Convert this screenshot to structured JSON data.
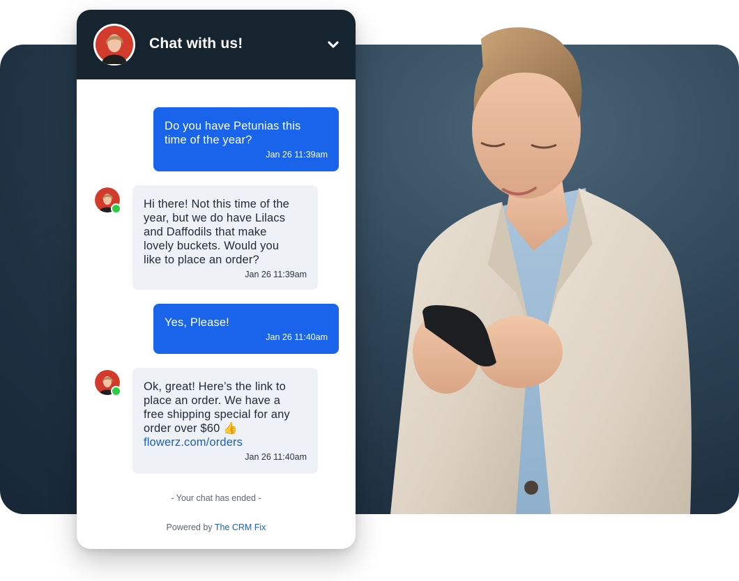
{
  "colors": {
    "header_bg": "#16242f",
    "outgoing_bubble": "#1a63eb",
    "incoming_bubble": "#eef2f6",
    "link": "#1b5fb8",
    "online_status": "#2ecc40",
    "backdrop": "#2f4658"
  },
  "chat": {
    "title": "Chat with us!",
    "toggle_icon": "chevron-down-icon",
    "messages": [
      {
        "direction": "outgoing",
        "text": "Do you have Petunias this\ntime of the year?",
        "time": "Jan 26  11:39am"
      },
      {
        "direction": "incoming",
        "text": "Hi there! Not this time of the\nyear, but we do have Lilacs\nand Daffodils that make\nlovely buckets. Would you\nlike to place an order?",
        "time": "Jan 26  11:39am"
      },
      {
        "direction": "outgoing",
        "text": "Yes, Please!",
        "time": "Jan 26  11:40am"
      },
      {
        "direction": "incoming",
        "text": "Ok, great! Here’s the link to\nplace an order. We have a\nfree shipping special for any\norder over $60 👍",
        "link": "flowerz.com/orders",
        "time": "Jan 26  11:40am"
      }
    ],
    "ended_text": "- Your chat has ended -",
    "powered_prefix": "Powered by ",
    "powered_brand": "The CRM Fix"
  }
}
